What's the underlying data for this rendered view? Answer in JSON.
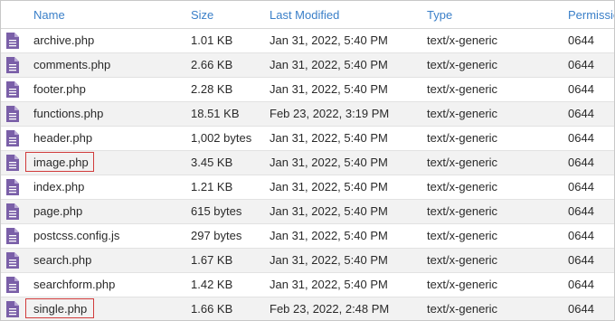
{
  "columns": {
    "name": "Name",
    "size": "Size",
    "last_modified": "Last Modified",
    "type": "Type",
    "permissions": "Permissio"
  },
  "colors": {
    "header_link": "#3a7fc8",
    "file_icon": "#7a5fa8",
    "highlight_border": "#d13b3b",
    "row_alt": "#f2f2f2"
  },
  "file_icon_name": "document-file-icon",
  "files": [
    {
      "name": "archive.php",
      "size": "1.01 KB",
      "modified": "Jan 31, 2022, 5:40 PM",
      "type": "text/x-generic",
      "perm": "0644",
      "highlighted": false
    },
    {
      "name": "comments.php",
      "size": "2.66 KB",
      "modified": "Jan 31, 2022, 5:40 PM",
      "type": "text/x-generic",
      "perm": "0644",
      "highlighted": false
    },
    {
      "name": "footer.php",
      "size": "2.28 KB",
      "modified": "Jan 31, 2022, 5:40 PM",
      "type": "text/x-generic",
      "perm": "0644",
      "highlighted": false
    },
    {
      "name": "functions.php",
      "size": "18.51 KB",
      "modified": "Feb 23, 2022, 3:19 PM",
      "type": "text/x-generic",
      "perm": "0644",
      "highlighted": false
    },
    {
      "name": "header.php",
      "size": "1,002 bytes",
      "modified": "Jan 31, 2022, 5:40 PM",
      "type": "text/x-generic",
      "perm": "0644",
      "highlighted": false
    },
    {
      "name": "image.php",
      "size": "3.45 KB",
      "modified": "Jan 31, 2022, 5:40 PM",
      "type": "text/x-generic",
      "perm": "0644",
      "highlighted": true
    },
    {
      "name": "index.php",
      "size": "1.21 KB",
      "modified": "Jan 31, 2022, 5:40 PM",
      "type": "text/x-generic",
      "perm": "0644",
      "highlighted": false
    },
    {
      "name": "page.php",
      "size": "615 bytes",
      "modified": "Jan 31, 2022, 5:40 PM",
      "type": "text/x-generic",
      "perm": "0644",
      "highlighted": false
    },
    {
      "name": "postcss.config.js",
      "size": "297 bytes",
      "modified": "Jan 31, 2022, 5:40 PM",
      "type": "text/x-generic",
      "perm": "0644",
      "highlighted": false
    },
    {
      "name": "search.php",
      "size": "1.67 KB",
      "modified": "Jan 31, 2022, 5:40 PM",
      "type": "text/x-generic",
      "perm": "0644",
      "highlighted": false
    },
    {
      "name": "searchform.php",
      "size": "1.42 KB",
      "modified": "Jan 31, 2022, 5:40 PM",
      "type": "text/x-generic",
      "perm": "0644",
      "highlighted": false
    },
    {
      "name": "single.php",
      "size": "1.66 KB",
      "modified": "Feb 23, 2022, 2:48 PM",
      "type": "text/x-generic",
      "perm": "0644",
      "highlighted": true
    }
  ]
}
